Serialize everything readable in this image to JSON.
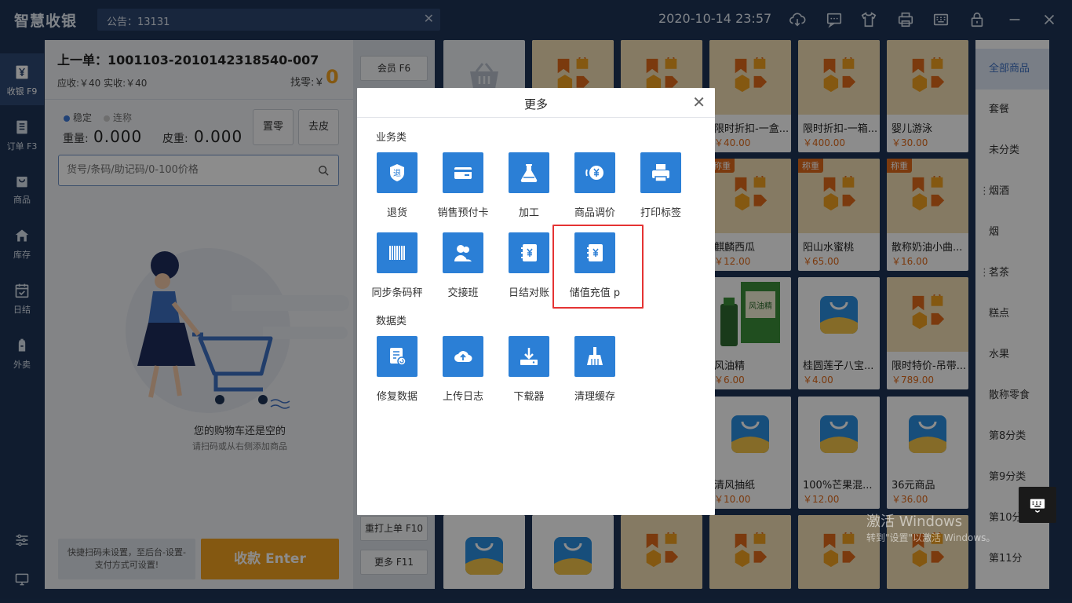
{
  "app": {
    "title": "智慧收银",
    "notice": "公告：13131",
    "datetime": "2020-10-14 23:57"
  },
  "nav": [
    {
      "label": "收银 F9",
      "icon": "yen-icon"
    },
    {
      "label": "订单 F3",
      "icon": "order-icon"
    },
    {
      "label": "商品",
      "icon": "bag-icon"
    },
    {
      "label": "库存",
      "icon": "house-icon"
    },
    {
      "label": "日结",
      "icon": "calendar-icon"
    },
    {
      "label": "外卖",
      "icon": "takeout-icon"
    }
  ],
  "order": {
    "last_order": "上一单：1001103-2010142318540-007",
    "received": "应收:￥40   实收:￥40",
    "change_label": "找零:￥",
    "change_value": "0"
  },
  "scale": {
    "stable": "稳定",
    "continuous": "连称",
    "weight_label": "重量:",
    "weight_value": "0.000",
    "tare_label": "皮重:",
    "tare_value": "0.000",
    "zero_btn": "置零",
    "tare_btn": "去皮"
  },
  "search": {
    "placeholder": "货号/条码/助记码/0-100价格"
  },
  "cart": {
    "empty_text": "您的购物车还是空的",
    "empty_hint": "请扫码或从右侧添加商品"
  },
  "footer": {
    "shortcut_tip_1": "快捷扫码未设置，至后台-设置-",
    "shortcut_tip_2": "支付方式可设置!",
    "pay_label": "收款 Enter"
  },
  "mid_buttons": {
    "member": "会员 F6",
    "reprint": "重打上单 F10",
    "more": "更多 F11"
  },
  "products": [
    {
      "name": "限时折扣-一盒...",
      "price": "￥40.00",
      "badge": ""
    },
    {
      "name": "限时折扣-一箱...",
      "price": "￥400.00",
      "badge": ""
    },
    {
      "name": "婴儿游泳",
      "price": "￥30.00",
      "badge": ""
    },
    {
      "name": "麒麟西瓜",
      "price": "￥12.00",
      "badge": "称重"
    },
    {
      "name": "阳山水蜜桃",
      "price": "￥65.00",
      "badge": "称重"
    },
    {
      "name": "散称奶油小曲...",
      "price": "￥16.00",
      "badge": "称重"
    },
    {
      "name": "风油精",
      "price": "￥6.00",
      "badge": ""
    },
    {
      "name": "桂圆莲子八宝...",
      "price": "￥4.00",
      "badge": ""
    },
    {
      "name": "限时特价-吊带...",
      "price": "￥789.00",
      "badge": ""
    },
    {
      "name": "清风抽纸",
      "price": "￥10.00",
      "badge": ""
    },
    {
      "name": "100%芒果混...",
      "price": "￥12.00",
      "badge": ""
    },
    {
      "name": "36元商品",
      "price": "￥36.00",
      "badge": ""
    }
  ],
  "product_label": {
    "fengyoujing": "风油精"
  },
  "categories": [
    "全部商品",
    "套餐",
    "未分类",
    "烟酒",
    "烟",
    "茗茶",
    "糕点",
    "水果",
    "散称零食",
    "第8分类",
    "第9分类",
    "第10分类",
    "第11分"
  ],
  "watermark": {
    "line1": "激活 Windows",
    "line2": "转到\"设置\"以激活 Windows。"
  },
  "modal": {
    "title": "更多",
    "section_business": "业务类",
    "section_data": "数据类",
    "business_tools": [
      "退货",
      "销售预付卡",
      "加工",
      "商品调价",
      "打印标签",
      "同步条码秤",
      "交接班",
      "日结对账",
      "储值充值 p"
    ],
    "data_tools": [
      "修复数据",
      "上传日志",
      "下载器",
      "清理缓存"
    ],
    "return_glyph": "退"
  },
  "colors": {
    "accent": "#2b7fd6",
    "orange": "#f0a020",
    "bg": "#1e3457",
    "highlight": "#e53333"
  }
}
